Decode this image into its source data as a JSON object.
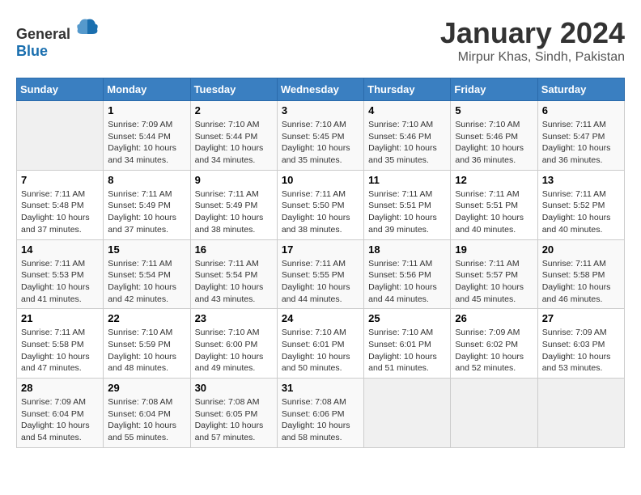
{
  "logo": {
    "general": "General",
    "blue": "Blue"
  },
  "title": "January 2024",
  "subtitle": "Mirpur Khas, Sindh, Pakistan",
  "weekdays": [
    "Sunday",
    "Monday",
    "Tuesday",
    "Wednesday",
    "Thursday",
    "Friday",
    "Saturday"
  ],
  "weeks": [
    [
      {
        "day": "",
        "info": ""
      },
      {
        "day": "1",
        "info": "Sunrise: 7:09 AM\nSunset: 5:44 PM\nDaylight: 10 hours\nand 34 minutes."
      },
      {
        "day": "2",
        "info": "Sunrise: 7:10 AM\nSunset: 5:44 PM\nDaylight: 10 hours\nand 34 minutes."
      },
      {
        "day": "3",
        "info": "Sunrise: 7:10 AM\nSunset: 5:45 PM\nDaylight: 10 hours\nand 35 minutes."
      },
      {
        "day": "4",
        "info": "Sunrise: 7:10 AM\nSunset: 5:46 PM\nDaylight: 10 hours\nand 35 minutes."
      },
      {
        "day": "5",
        "info": "Sunrise: 7:10 AM\nSunset: 5:46 PM\nDaylight: 10 hours\nand 36 minutes."
      },
      {
        "day": "6",
        "info": "Sunrise: 7:11 AM\nSunset: 5:47 PM\nDaylight: 10 hours\nand 36 minutes."
      }
    ],
    [
      {
        "day": "7",
        "info": "Sunrise: 7:11 AM\nSunset: 5:48 PM\nDaylight: 10 hours\nand 37 minutes."
      },
      {
        "day": "8",
        "info": "Sunrise: 7:11 AM\nSunset: 5:49 PM\nDaylight: 10 hours\nand 37 minutes."
      },
      {
        "day": "9",
        "info": "Sunrise: 7:11 AM\nSunset: 5:49 PM\nDaylight: 10 hours\nand 38 minutes."
      },
      {
        "day": "10",
        "info": "Sunrise: 7:11 AM\nSunset: 5:50 PM\nDaylight: 10 hours\nand 38 minutes."
      },
      {
        "day": "11",
        "info": "Sunrise: 7:11 AM\nSunset: 5:51 PM\nDaylight: 10 hours\nand 39 minutes."
      },
      {
        "day": "12",
        "info": "Sunrise: 7:11 AM\nSunset: 5:51 PM\nDaylight: 10 hours\nand 40 minutes."
      },
      {
        "day": "13",
        "info": "Sunrise: 7:11 AM\nSunset: 5:52 PM\nDaylight: 10 hours\nand 40 minutes."
      }
    ],
    [
      {
        "day": "14",
        "info": "Sunrise: 7:11 AM\nSunset: 5:53 PM\nDaylight: 10 hours\nand 41 minutes."
      },
      {
        "day": "15",
        "info": "Sunrise: 7:11 AM\nSunset: 5:54 PM\nDaylight: 10 hours\nand 42 minutes."
      },
      {
        "day": "16",
        "info": "Sunrise: 7:11 AM\nSunset: 5:54 PM\nDaylight: 10 hours\nand 43 minutes."
      },
      {
        "day": "17",
        "info": "Sunrise: 7:11 AM\nSunset: 5:55 PM\nDaylight: 10 hours\nand 44 minutes."
      },
      {
        "day": "18",
        "info": "Sunrise: 7:11 AM\nSunset: 5:56 PM\nDaylight: 10 hours\nand 44 minutes."
      },
      {
        "day": "19",
        "info": "Sunrise: 7:11 AM\nSunset: 5:57 PM\nDaylight: 10 hours\nand 45 minutes."
      },
      {
        "day": "20",
        "info": "Sunrise: 7:11 AM\nSunset: 5:58 PM\nDaylight: 10 hours\nand 46 minutes."
      }
    ],
    [
      {
        "day": "21",
        "info": "Sunrise: 7:11 AM\nSunset: 5:58 PM\nDaylight: 10 hours\nand 47 minutes."
      },
      {
        "day": "22",
        "info": "Sunrise: 7:10 AM\nSunset: 5:59 PM\nDaylight: 10 hours\nand 48 minutes."
      },
      {
        "day": "23",
        "info": "Sunrise: 7:10 AM\nSunset: 6:00 PM\nDaylight: 10 hours\nand 49 minutes."
      },
      {
        "day": "24",
        "info": "Sunrise: 7:10 AM\nSunset: 6:01 PM\nDaylight: 10 hours\nand 50 minutes."
      },
      {
        "day": "25",
        "info": "Sunrise: 7:10 AM\nSunset: 6:01 PM\nDaylight: 10 hours\nand 51 minutes."
      },
      {
        "day": "26",
        "info": "Sunrise: 7:09 AM\nSunset: 6:02 PM\nDaylight: 10 hours\nand 52 minutes."
      },
      {
        "day": "27",
        "info": "Sunrise: 7:09 AM\nSunset: 6:03 PM\nDaylight: 10 hours\nand 53 minutes."
      }
    ],
    [
      {
        "day": "28",
        "info": "Sunrise: 7:09 AM\nSunset: 6:04 PM\nDaylight: 10 hours\nand 54 minutes."
      },
      {
        "day": "29",
        "info": "Sunrise: 7:08 AM\nSunset: 6:04 PM\nDaylight: 10 hours\nand 55 minutes."
      },
      {
        "day": "30",
        "info": "Sunrise: 7:08 AM\nSunset: 6:05 PM\nDaylight: 10 hours\nand 57 minutes."
      },
      {
        "day": "31",
        "info": "Sunrise: 7:08 AM\nSunset: 6:06 PM\nDaylight: 10 hours\nand 58 minutes."
      },
      {
        "day": "",
        "info": ""
      },
      {
        "day": "",
        "info": ""
      },
      {
        "day": "",
        "info": ""
      }
    ]
  ]
}
